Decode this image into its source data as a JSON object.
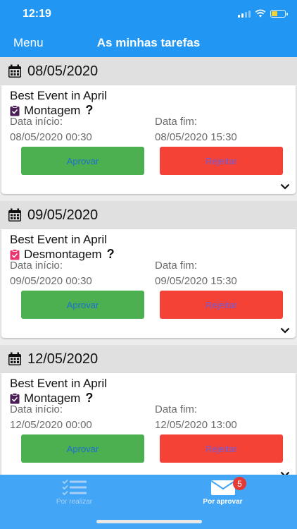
{
  "status_bar": {
    "time": "12:19"
  },
  "nav": {
    "menu_label": "Menu",
    "title": "As minhas tarefas"
  },
  "groups": [
    {
      "date": "08/05/2020",
      "event": "Best Event in April",
      "task": "Montagem",
      "task_icon": "clipboard-check-icon",
      "task_icon_color": "#4a1f55",
      "start_label": "Data início:",
      "start_value": "08/05/2020 00:30",
      "end_label": "Data fim:",
      "end_value": "08/05/2020 15:30",
      "approve_label": "Aprovar",
      "reject_label": "Rejeitar"
    },
    {
      "date": "09/05/2020",
      "event": "Best Event in April",
      "task": "Desmontagem",
      "task_icon": "clipboard-check-icon",
      "task_icon_color": "#e8366e",
      "start_label": "Data início:",
      "start_value": "09/05/2020 00:30",
      "end_label": "Data fim:",
      "end_value": "09/05/2020 15:30",
      "approve_label": "Aprovar",
      "reject_label": "Rejeitar"
    },
    {
      "date": "12/05/2020",
      "event": "Best Event in April",
      "task": "Montagem",
      "task_icon": "clipboard-check-icon",
      "task_icon_color": "#4a1f55",
      "start_label": "Data início:",
      "start_value": "12/05/2020 00:00",
      "end_label": "Data fim:",
      "end_value": "12/05/2020 13:00",
      "approve_label": "Aprovar",
      "reject_label": "Rejeitar"
    }
  ],
  "tabbar": {
    "tab_left_label": "Por realizar",
    "tab_right_label": "Por aprovar",
    "badge_count": "5"
  },
  "colors": {
    "header": "#2196F3",
    "tabbar": "#42A5F5",
    "approve": "#4CAF50",
    "reject": "#F44336"
  }
}
